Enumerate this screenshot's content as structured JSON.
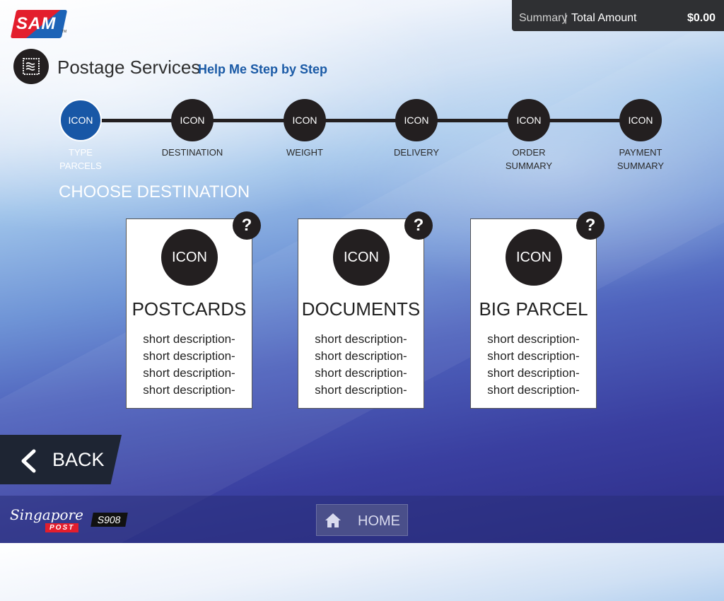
{
  "brand": {
    "logo_text": "SAM",
    "logo_tm": "TM"
  },
  "summary": {
    "label": "Summary",
    "separator": "|",
    "total_label": "Total Amount",
    "amount": "$0.00"
  },
  "header": {
    "title": "Postage Services",
    "help_link": "Help Me Step by Step",
    "icon": "stamp-icon"
  },
  "steps": [
    {
      "icon_text": "ICON",
      "label_line1": "TYPE",
      "label_line2": "PARCELS",
      "active": true
    },
    {
      "icon_text": "ICON",
      "label_line1": "DESTINATION",
      "label_line2": ""
    },
    {
      "icon_text": "ICON",
      "label_line1": "WEIGHT",
      "label_line2": ""
    },
    {
      "icon_text": "ICON",
      "label_line1": "DELIVERY",
      "label_line2": ""
    },
    {
      "icon_text": "ICON",
      "label_line1": "ORDER",
      "label_line2": "SUMMARY"
    },
    {
      "icon_text": "ICON",
      "label_line1": "PAYMENT",
      "label_line2": "SUMMARY"
    }
  ],
  "section_title": "CHOOSE DESTINATION",
  "cards": [
    {
      "icon_text": "ICON",
      "title": "POSTCARDS",
      "help": "?",
      "desc": [
        "short description-",
        "short description-",
        "short description-",
        "short description-"
      ]
    },
    {
      "icon_text": "ICON",
      "title": "DOCUMENTS",
      "help": "?",
      "desc": [
        "short description-",
        "short description-",
        "short description-",
        "short description-"
      ]
    },
    {
      "icon_text": "ICON",
      "title": "BIG PARCEL",
      "help": "?",
      "desc": [
        "short description-",
        "short description-",
        "short description-",
        "short description-"
      ]
    }
  ],
  "back": {
    "label": "BACK",
    "icon": "chevron-left-icon"
  },
  "home": {
    "label": "HOME",
    "icon": "home-icon"
  },
  "footer": {
    "sp_logo_script": "Singapore",
    "sp_logo_post": "POST",
    "kiosk_code": "S908"
  },
  "colors": {
    "active_step": "#1857a6",
    "dark": "#231f20",
    "link": "#1a5aa6",
    "brand_red": "#e31e2d"
  }
}
